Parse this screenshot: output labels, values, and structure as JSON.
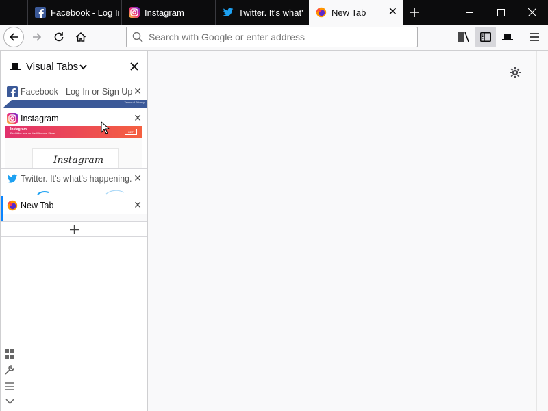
{
  "tabs": [
    {
      "title": "Facebook - Log In or Sign Up",
      "favicon": "facebook-icon"
    },
    {
      "title": "Instagram",
      "favicon": "instagram-icon"
    },
    {
      "title": "Twitter. It's what's happening.",
      "favicon": "twitter-icon"
    },
    {
      "title": "New Tab",
      "favicon": "firefox-icon",
      "active": true
    }
  ],
  "toolbar": {
    "search_placeholder": "Search with Google or enter address"
  },
  "sidebar": {
    "title": "Visual Tabs",
    "tabs": [
      {
        "title": "Facebook - Log In or Sign Up",
        "favicon": "facebook-icon"
      },
      {
        "title": "Instagram",
        "favicon": "instagram-icon",
        "preview_banner": "Instagram",
        "preview_banner_sub": "Find it for free on the Windows Store.",
        "preview_get": "GET",
        "preview_logo": "Instagram"
      },
      {
        "title": "Twitter. It's what's happening.",
        "favicon": "twitter-icon"
      },
      {
        "title": "New Tab",
        "favicon": "firefox-icon",
        "active": true
      }
    ],
    "facebook_footer_text": "Terms of Privacy"
  },
  "colors": {
    "tabstrip_bg": "#0c0c0d",
    "facebook_blue": "#3b5998",
    "twitter_blue": "#1da1f2",
    "active_tab_accent": "#0a84ff",
    "instagram_gradient": "#e1306c"
  }
}
